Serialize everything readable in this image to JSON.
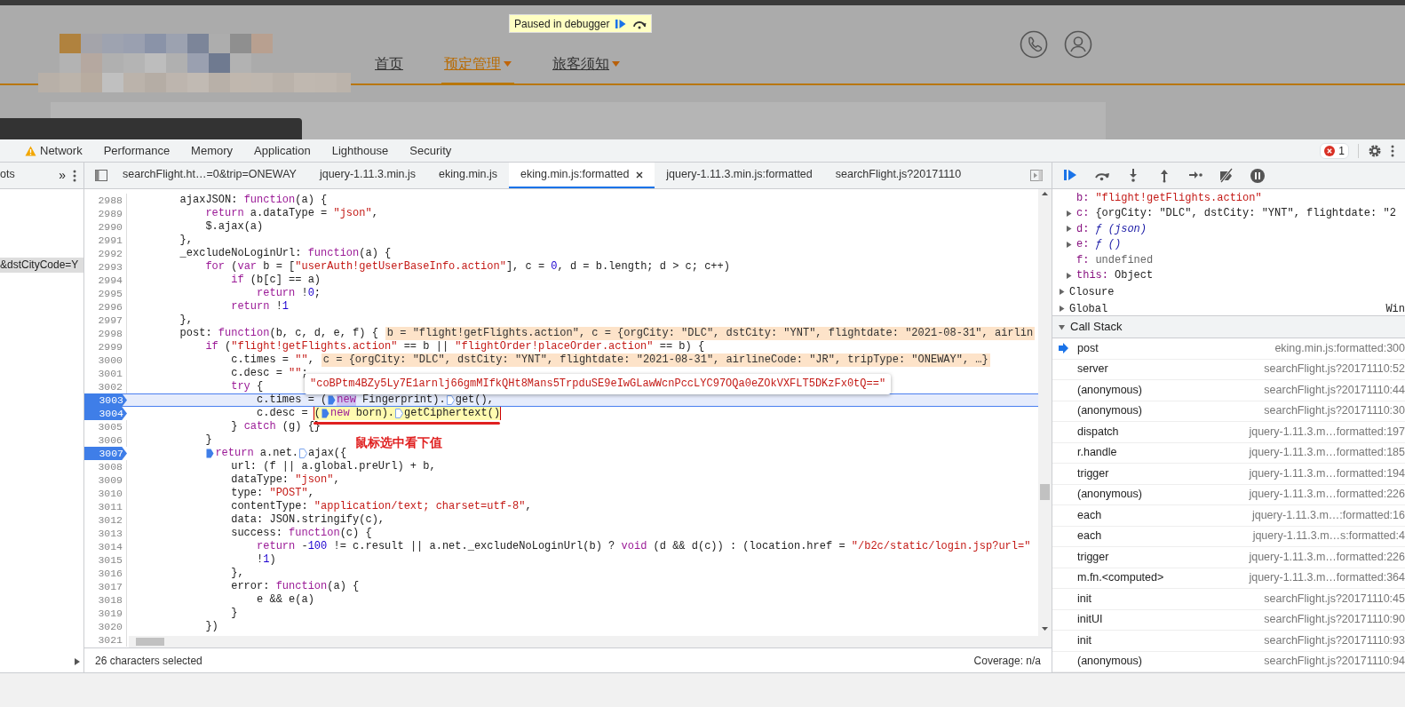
{
  "site": {
    "debugger_badge": {
      "text": "Paused in debugger"
    },
    "nav": [
      {
        "label": "首页",
        "selected": false,
        "dropdown": false
      },
      {
        "label": "预定管理",
        "selected": true,
        "dropdown": true
      },
      {
        "label": "旅客须知",
        "selected": false,
        "dropdown": true
      }
    ]
  },
  "devtools": {
    "panel_tabs": [
      {
        "label": "Network",
        "warning": true
      },
      {
        "label": "Performance",
        "warning": false
      },
      {
        "label": "Memory",
        "warning": false
      },
      {
        "label": "Application",
        "warning": false
      },
      {
        "label": "Lighthouse",
        "warning": false
      },
      {
        "label": "Security",
        "warning": false
      }
    ],
    "error_count": "1",
    "navigator": {
      "tab": "ots",
      "more": "»",
      "items": [
        {
          "text": "&dstCityCode=Y",
          "selected": true
        }
      ]
    },
    "file_tabs": [
      {
        "label": "searchFlight.ht…=0&trip=ONEWAY",
        "selected": false,
        "closable": false
      },
      {
        "label": "jquery-1.11.3.min.js",
        "selected": false,
        "closable": false
      },
      {
        "label": "eking.min.js",
        "selected": false,
        "closable": false
      },
      {
        "label": "eking.min.js:formatted",
        "selected": true,
        "closable": true
      },
      {
        "label": "jquery-1.11.3.min.js:formatted",
        "selected": false,
        "closable": false
      },
      {
        "label": "searchFlight.js?20171110",
        "selected": false,
        "closable": false
      }
    ],
    "code": {
      "lines": [
        {
          "number": "2988",
          "breakpoint": false,
          "current": false,
          "tokens": [
            {
              "kind": "plain",
              "text": "        ajaxJSON: "
            },
            {
              "kind": "kw",
              "text": "function"
            },
            {
              "kind": "plain",
              "text": "(a) {"
            }
          ]
        },
        {
          "number": "2989",
          "breakpoint": false,
          "current": false,
          "tokens": [
            {
              "kind": "kw",
              "text": "            return"
            },
            {
              "kind": "plain",
              "text": " a.dataType = "
            },
            {
              "kind": "str",
              "text": "\"json\""
            },
            {
              "kind": "plain",
              "text": ","
            }
          ]
        },
        {
          "number": "2990",
          "breakpoint": false,
          "current": false,
          "tokens": [
            {
              "kind": "plain",
              "text": "            $.ajax(a)"
            }
          ]
        },
        {
          "number": "2991",
          "breakpoint": false,
          "current": false,
          "tokens": [
            {
              "kind": "plain",
              "text": "        },"
            }
          ]
        },
        {
          "number": "2992",
          "breakpoint": false,
          "current": false,
          "tokens": [
            {
              "kind": "plain",
              "text": "        _excludeNoLoginUrl: "
            },
            {
              "kind": "kw",
              "text": "function"
            },
            {
              "kind": "plain",
              "text": "(a) {"
            }
          ]
        },
        {
          "number": "2993",
          "breakpoint": false,
          "current": false,
          "tokens": [
            {
              "kind": "kw",
              "text": "            for"
            },
            {
              "kind": "plain",
              "text": " ("
            },
            {
              "kind": "kw",
              "text": "var"
            },
            {
              "kind": "plain",
              "text": " b = ["
            },
            {
              "kind": "str",
              "text": "\"userAuth!getUserBaseInfo.action\""
            },
            {
              "kind": "plain",
              "text": "], c = "
            },
            {
              "kind": "num",
              "text": "0"
            },
            {
              "kind": "plain",
              "text": ", d = b.length; d > c; c++)"
            }
          ]
        },
        {
          "number": "2994",
          "breakpoint": false,
          "current": false,
          "tokens": [
            {
              "kind": "kw",
              "text": "                if"
            },
            {
              "kind": "plain",
              "text": " (b[c] == a)"
            }
          ]
        },
        {
          "number": "2995",
          "breakpoint": false,
          "current": false,
          "tokens": [
            {
              "kind": "kw",
              "text": "                    return"
            },
            {
              "kind": "plain",
              "text": " !"
            },
            {
              "kind": "num",
              "text": "0"
            },
            {
              "kind": "plain",
              "text": ";"
            }
          ]
        },
        {
          "number": "2996",
          "breakpoint": false,
          "current": false,
          "tokens": [
            {
              "kind": "kw",
              "text": "                return"
            },
            {
              "kind": "plain",
              "text": " !"
            },
            {
              "kind": "num",
              "text": "1"
            }
          ]
        },
        {
          "number": "2997",
          "breakpoint": false,
          "current": false,
          "tokens": [
            {
              "kind": "plain",
              "text": "        },"
            }
          ]
        },
        {
          "number": "2998",
          "breakpoint": false,
          "current": false,
          "tokens": [
            {
              "kind": "plain",
              "text": "        post: "
            },
            {
              "kind": "kw",
              "text": "function"
            },
            {
              "kind": "plain",
              "text": "(b, c, d, e, f) {"
            }
          ],
          "inline_value": "b = \"flight!getFlights.action\", c = {orgCity: \"DLC\", dstCity: \"YNT\", flightdate: \"2021-08-31\", airlin"
        },
        {
          "number": "2999",
          "breakpoint": false,
          "current": false,
          "tokens": [
            {
              "kind": "kw",
              "text": "            if"
            },
            {
              "kind": "plain",
              "text": " ("
            },
            {
              "kind": "str",
              "text": "\"flight!getFlights.action\""
            },
            {
              "kind": "plain",
              "text": " == b || "
            },
            {
              "kind": "str",
              "text": "\"flightOrder!placeOrder.action\""
            },
            {
              "kind": "plain",
              "text": " == b) {"
            }
          ]
        },
        {
          "number": "3000",
          "breakpoint": false,
          "current": false,
          "tokens": [
            {
              "kind": "plain",
              "text": "                c.times = "
            },
            {
              "kind": "str",
              "text": "\"\""
            },
            {
              "kind": "plain",
              "text": ","
            }
          ],
          "inline_value": "c = {orgCity: \"DLC\", dstCity: \"YNT\", flightdate: \"2021-08-31\", airlineCode: \"JR\", tripType: \"ONEWAY\", …}"
        },
        {
          "number": "3001",
          "breakpoint": false,
          "current": false,
          "tokens": [
            {
              "kind": "plain",
              "text": "                c.desc = "
            },
            {
              "kind": "str",
              "text": "\"\""
            },
            {
              "kind": "plain",
              "text": ";"
            }
          ]
        },
        {
          "number": "3002",
          "breakpoint": false,
          "current": false,
          "tokens": [
            {
              "kind": "kw",
              "text": "                try"
            },
            {
              "kind": "plain",
              "text": " {"
            }
          ]
        },
        {
          "number": "3003",
          "breakpoint": true,
          "current": true,
          "tokens": [
            {
              "kind": "plain",
              "text": "                    c.times = ("
            },
            {
              "kind": "kw",
              "text": "new",
              "match": true,
              "marker": true,
              "marker_active": true
            },
            {
              "kind": "plain",
              "text": " Fingerprint)."
            },
            {
              "kind": "plain",
              "text": "get(),",
              "marker": true,
              "marker_active": false
            }
          ]
        },
        {
          "number": "3004",
          "breakpoint": true,
          "current": false,
          "tokens": [
            {
              "kind": "plain",
              "text": "                    c.desc = "
            }
          ],
          "selection": [
            {
              "kind": "plain",
              "text": "("
            },
            {
              "kind": "kw",
              "text": "new",
              "marker": true,
              "marker_active": true
            },
            {
              "kind": "plain",
              "text": " born)."
            },
            {
              "kind": "plain",
              "text": "getCiphertext()",
              "marker": true,
              "marker_active": false
            }
          ]
        },
        {
          "number": "3005",
          "breakpoint": false,
          "current": false,
          "tokens": [
            {
              "kind": "plain",
              "text": "                } "
            },
            {
              "kind": "kw",
              "text": "catch"
            },
            {
              "kind": "plain",
              "text": " (g) {}"
            }
          ]
        },
        {
          "number": "3006",
          "breakpoint": false,
          "current": false,
          "tokens": [
            {
              "kind": "plain",
              "text": "            }"
            }
          ]
        },
        {
          "number": "3007",
          "breakpoint": true,
          "current": false,
          "tokens": [
            {
              "kind": "kw",
              "text": "            return",
              "marker": true,
              "marker_active": true
            },
            {
              "kind": "plain",
              "text": " a.net."
            },
            {
              "kind": "plain",
              "text": "ajax({",
              "marker": true,
              "marker_active": false
            }
          ]
        },
        {
          "number": "3008",
          "breakpoint": false,
          "current": false,
          "tokens": [
            {
              "kind": "plain",
              "text": "                url: (f || a.global.preUrl) + b,"
            }
          ]
        },
        {
          "number": "3009",
          "breakpoint": false,
          "current": false,
          "tokens": [
            {
              "kind": "plain",
              "text": "                dataType: "
            },
            {
              "kind": "str",
              "text": "\"json\""
            },
            {
              "kind": "plain",
              "text": ","
            }
          ]
        },
        {
          "number": "3010",
          "breakpoint": false,
          "current": false,
          "tokens": [
            {
              "kind": "plain",
              "text": "                type: "
            },
            {
              "kind": "str",
              "text": "\"POST\""
            },
            {
              "kind": "plain",
              "text": ","
            }
          ]
        },
        {
          "number": "3011",
          "breakpoint": false,
          "current": false,
          "tokens": [
            {
              "kind": "plain",
              "text": "                contentType: "
            },
            {
              "kind": "str",
              "text": "\"application/text; charset=utf-8\""
            },
            {
              "kind": "plain",
              "text": ","
            }
          ]
        },
        {
          "number": "3012",
          "breakpoint": false,
          "current": false,
          "tokens": [
            {
              "kind": "plain",
              "text": "                data: JSON.stringify(c),"
            }
          ]
        },
        {
          "number": "3013",
          "breakpoint": false,
          "current": false,
          "tokens": [
            {
              "kind": "plain",
              "text": "                success: "
            },
            {
              "kind": "kw",
              "text": "function"
            },
            {
              "kind": "plain",
              "text": "(c) {"
            }
          ]
        },
        {
          "number": "3014",
          "breakpoint": false,
          "current": false,
          "tokens": [
            {
              "kind": "kw",
              "text": "                    return"
            },
            {
              "kind": "plain",
              "text": " -"
            },
            {
              "kind": "num",
              "text": "100"
            },
            {
              "kind": "plain",
              "text": " != c.result || a.net._excludeNoLoginUrl(b) ? "
            },
            {
              "kind": "kw",
              "text": "void"
            },
            {
              "kind": "plain",
              "text": " (d && d(c)) : (location.href = "
            },
            {
              "kind": "str",
              "text": "\"/b2c/static/login.jsp?url=\""
            }
          ]
        },
        {
          "number": "3015",
          "breakpoint": false,
          "current": false,
          "tokens": [
            {
              "kind": "plain",
              "text": "                    !"
            },
            {
              "kind": "num",
              "text": "1"
            },
            {
              "kind": "plain",
              "text": ")"
            }
          ]
        },
        {
          "number": "3016",
          "breakpoint": false,
          "current": false,
          "tokens": [
            {
              "kind": "plain",
              "text": "                },"
            }
          ]
        },
        {
          "number": "3017",
          "breakpoint": false,
          "current": false,
          "tokens": [
            {
              "kind": "plain",
              "text": "                error: "
            },
            {
              "kind": "kw",
              "text": "function"
            },
            {
              "kind": "plain",
              "text": "(a) {"
            }
          ]
        },
        {
          "number": "3018",
          "breakpoint": false,
          "current": false,
          "tokens": [
            {
              "kind": "plain",
              "text": "                    e && e(a)"
            }
          ]
        },
        {
          "number": "3019",
          "breakpoint": false,
          "current": false,
          "tokens": [
            {
              "kind": "plain",
              "text": "                }"
            }
          ]
        },
        {
          "number": "3020",
          "breakpoint": false,
          "current": false,
          "tokens": [
            {
              "kind": "plain",
              "text": "            })"
            }
          ]
        },
        {
          "number": "3021",
          "breakpoint": false,
          "current": false
        }
      ],
      "tooltip": {
        "text": "\"coBPtm4BZy5Ly7E1arnlj66gmMIfkQHt8Mans5TrpduSE9eIwGLawWcnPccLYC97OQa0eZOkVXFLT5DKzFx0tQ==\""
      },
      "annotation": {
        "text": "鼠标选中看下值"
      }
    },
    "status_bar": {
      "selection": "26 characters selected",
      "coverage": "Coverage: n/a"
    },
    "scope": [
      {
        "name": "b:",
        "value": "\"flight!getFlights.action\"",
        "kind": "string",
        "expandable": false
      },
      {
        "name": "c:",
        "value": "{orgCity: \"DLC\", dstCity: \"YNT\", flightdate: \"2",
        "kind": "object",
        "expandable": true
      },
      {
        "name": "d:",
        "value": "ƒ (json)",
        "kind": "function",
        "expandable": true
      },
      {
        "name": "e:",
        "value": "ƒ ()",
        "kind": "function",
        "expandable": true
      },
      {
        "name": "f:",
        "value": "undefined",
        "kind": "undefined",
        "expandable": false
      },
      {
        "name": "this:",
        "value": "Object",
        "kind": "object",
        "expandable": true
      }
    ],
    "scope_sections": [
      {
        "label": "Closure",
        "expanded": false
      },
      {
        "label": "Global",
        "expanded": false,
        "value": "Win"
      }
    ],
    "call_stack": {
      "label": "Call Stack",
      "expanded": true,
      "frames": [
        {
          "function": "post",
          "location": "eking.min.js:formatted:300",
          "current": true
        },
        {
          "function": "server",
          "location": "searchFlight.js?20171110:52",
          "current": false
        },
        {
          "function": "(anonymous)",
          "location": "searchFlight.js?20171110:44",
          "current": false
        },
        {
          "function": "(anonymous)",
          "location": "searchFlight.js?20171110:30",
          "current": false
        },
        {
          "function": "dispatch",
          "location": "jquery-1.11.3.m…formatted:197",
          "current": false
        },
        {
          "function": "r.handle",
          "location": "jquery-1.11.3.m…formatted:185",
          "current": false
        },
        {
          "function": "trigger",
          "location": "jquery-1.11.3.m…formatted:194",
          "current": false
        },
        {
          "function": "(anonymous)",
          "location": "jquery-1.11.3.m…formatted:226",
          "current": false
        },
        {
          "function": "each",
          "location": "jquery-1.11.3.m…:formatted:16",
          "current": false
        },
        {
          "function": "each",
          "location": "jquery-1.11.3.m…s:formatted:4",
          "current": false
        },
        {
          "function": "trigger",
          "location": "jquery-1.11.3.m…formatted:226",
          "current": false
        },
        {
          "function": "m.fn.<computed>",
          "location": "jquery-1.11.3.m…formatted:364",
          "current": false
        },
        {
          "function": "init",
          "location": "searchFlight.js?20171110:45",
          "current": false
        },
        {
          "function": "initUI",
          "location": "searchFlight.js?20171110:90",
          "current": false
        },
        {
          "function": "init",
          "location": "searchFlight.js?20171110:93",
          "current": false
        },
        {
          "function": "(anonymous)",
          "location": "searchFlight.js?20171110:94",
          "current": false
        }
      ]
    }
  }
}
